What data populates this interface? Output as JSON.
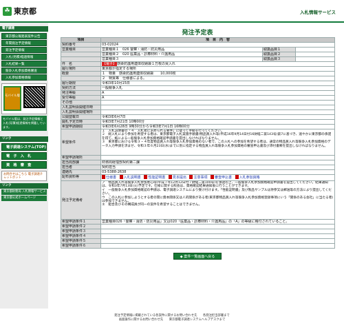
{
  "header": {
    "logo_text": "東京都",
    "site_title": "入札情報サービス"
  },
  "left": {
    "menu_head": "電子調達",
    "menu": [
      "東京都公報発表案件公告",
      "年間発注予定情報",
      "発注予定情報",
      "入札(見積)経過情報",
      "入札結果一覧",
      "競争入札参加資格審査",
      "入札参加資格情報"
    ],
    "mobile_label": "モバイル版",
    "mobile_note": "モバイル版は、発注予定情報と入札(見積)経過情報を掲載しています。",
    "links_title": "リンク",
    "big_buttons": [
      "電子調達システム(TOP)",
      "電　子　入　札",
      "資　格　審　査"
    ],
    "qa": "お問合せはこちら 電子調達チャットボット",
    "bottom_head": "リンク",
    "bottom_links": [
      "東京都財務局 入札情報サービス",
      "東京都公式ホームページ"
    ]
  },
  "page": {
    "title": "発注予定表",
    "col_item": "項目",
    "col_content": "項　目　内　容"
  },
  "rows": [
    {
      "k": "契約番号",
      "v": "03-02024"
    },
    {
      "k": "営業種目",
      "v": "営業種目１　026 警察・消防・防災用品"
    },
    {
      "k": "",
      "v": "営業種目２　020 医薬品・診療材料・介護用品"
    },
    {
      "k": "",
      "v": "営業種目３"
    },
    {
      "k": "件　名",
      "tag": "【電子】",
      "v": "感染防護用連体収納袋１万枚の買入れ"
    },
    {
      "k": "履行場所",
      "v": "東京都が指定する場所"
    },
    {
      "k": "概要",
      "v": "１　物量　感染防護用連体収納袋　　10,000枚"
    },
    {
      "k": "",
      "v": "２　特質等　仕様書による。"
    },
    {
      "k": "履行期限",
      "v": "令和3年10月15日"
    },
    {
      "k": "契約方法",
      "v": "一般競争入札"
    },
    {
      "k": "発注等級",
      "v": "A"
    },
    {
      "k": "受付等級",
      "v": "A"
    },
    {
      "k": "その他",
      "v": ""
    },
    {
      "k": "入札説明会開催日時",
      "v": ""
    },
    {
      "k": "入札説明会開催場所",
      "v": ""
    },
    {
      "k": "公開登載日",
      "v": "令和3年6月7日"
    },
    {
      "k": "開札予定日時",
      "v": "令和3年7月21日 10時00分"
    },
    {
      "k": "希望申請期間",
      "v": "令和3年6月28日 9時30分から令和3年7月1日 16時00分"
    }
  ],
  "subject_types": {
    "k1": "取扱品目１",
    "k2": "取扱品目２",
    "k3": "取扱品目３"
  },
  "hope": {
    "k": "希望条件",
    "lines": [
      "１　入札説明書の「４　入札者に求められる要件」に従って手続を行ってください。",
      "２　総入札により参加を希望する者は、東京都電子入札実施手順書(物品買入れ等)平成16年9月14日付16財経二第143号)第7に基づき、速やかに東京都の承諾を得て、紙による一般競争入札参加資格確認申請書を提出しなければなりません。",
      "３　東京都における令和３・４年度物品買入れ等競争入札参加資格のない者で、この入札への参加を希望する者は、通常の物品買入れ等競争入札参加資格のデータ入力申請を済ませ、令和３年６月23日(水)までに別に指定する物品買入れ等競争入札参加資格の審査申込書及び添付書類を提出しなければなりません。"
    ]
  },
  "rows2": [
    {
      "k": "希望申請場所",
      "v": ""
    },
    {
      "k": "担当局部課",
      "v": "財務局経理部契約第二課"
    },
    {
      "k": "担当者",
      "v": "契約担当"
    },
    {
      "k": "連絡先",
      "v": "03-5388-2638"
    }
  ],
  "files": {
    "k": "配布資料等",
    "items": [
      "仕様書",
      "入札説明書",
      "性能証明書",
      "見本提出",
      "注意事項",
      "審査申込書",
      "入札参加資格"
    ]
  },
  "remarks": {
    "k": "発注予定備考",
    "lines": [
      "ア　物品買入れ等競争入札参加者心得(平成７年12月12日付７財経二第100号)を承諾の上、一般競争入札参加資格確認申請書を提出してください。結果通知は、令和3年7月13日(火)予定です。仕様に関する照会は、資格確認結果通知後に行うことができます。",
      "イ　一般競争入札参加資格確認の申請は、電子調達システムにより受け付けます。「性能証明書」及び製品サンプルは持参又は郵送等の方法により提出してください。",
      "ウ　この入札に参加しようとする者の間に資本関係又は人的関係がある者(東京都物品買入れ等競争入札参加資格登録事項にいう「関係のある会社」に当たる者)は参加できません。",
      "エ　組合及びその構成員が同一の案件を希望することはできません。"
    ]
  },
  "rows3": [
    {
      "k": "希望申請条件１",
      "v": "営業種目026「警察・消防・防災用品」又は020「医薬品・診療材料・介護用品」の「A」の等級に格付されていること。"
    },
    {
      "k": "希望申請条件２",
      "v": ""
    },
    {
      "k": "希望申請条件３",
      "v": ""
    },
    {
      "k": "希望申請条件４",
      "v": ""
    },
    {
      "k": "希望申請条件５",
      "v": ""
    },
    {
      "k": "希望申請条件６",
      "v": ""
    }
  ],
  "list_button": "案件一覧画面へ戻る",
  "footer": [
    "発注予定情報に掲載されている各案件に関するお問い合わせ先　　各発注担当部署まで",
    "画面操作に関するお問い合わせ先　　東京都電子調達システムヘルプデスクまで"
  ]
}
